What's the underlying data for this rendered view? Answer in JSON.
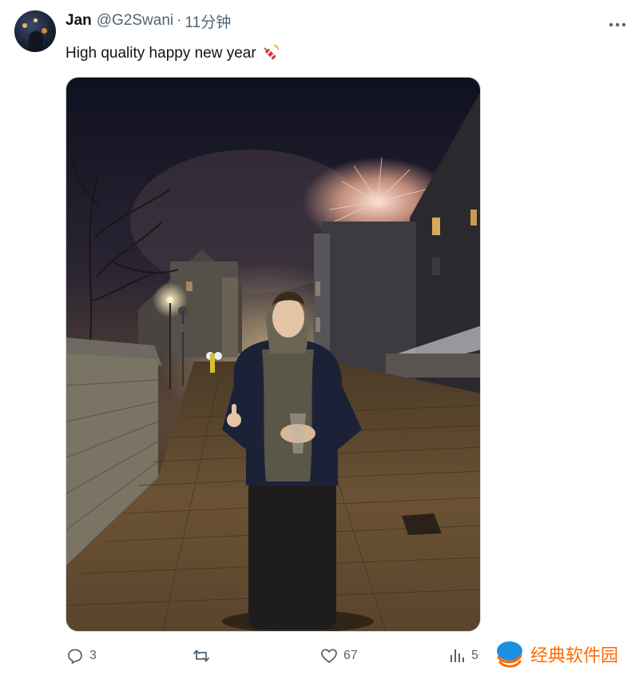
{
  "tweet": {
    "author_name": "Jan",
    "author_handle": "@G2Swani",
    "separator": "·",
    "timestamp": "11分钟",
    "text": "High quality happy new year",
    "emoji": "firecracker-emoji"
  },
  "media": {
    "type": "photo",
    "description_icon": "photo"
  },
  "actions": {
    "reply_count": "3",
    "retweet_count": "",
    "like_count": "67",
    "views_count": "5"
  },
  "watermark": {
    "text": "经典软件园"
  },
  "colors": {
    "text_primary": "#0f1419",
    "text_secondary": "#536471",
    "border": "#cfd9de",
    "watermark_orange": "#ff6a00",
    "watermark_blue": "#1d8fe1"
  }
}
